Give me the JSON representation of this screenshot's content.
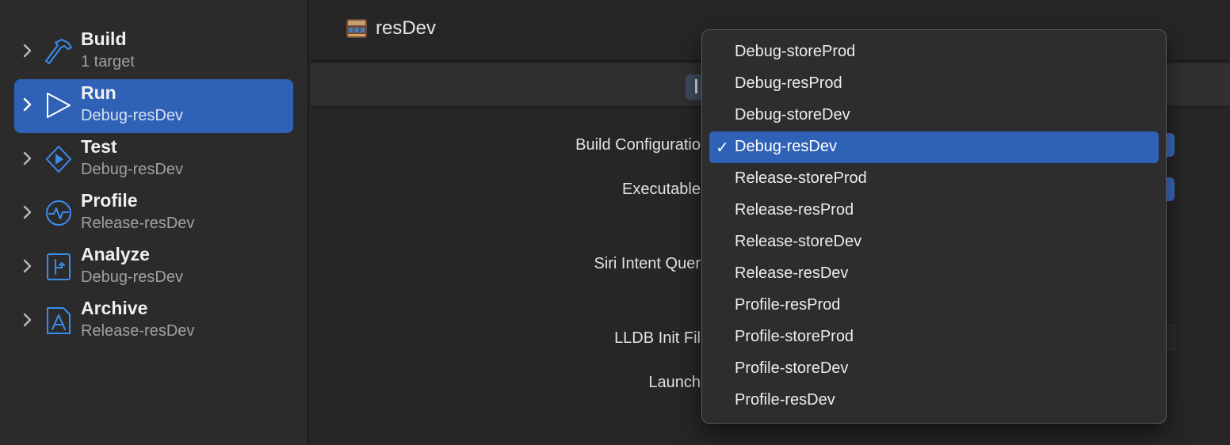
{
  "sidebar": {
    "items": [
      {
        "title": "Build",
        "subtitle": "1 target",
        "icon": "hammer-icon"
      },
      {
        "title": "Run",
        "subtitle": "Debug-resDev",
        "icon": "play-icon",
        "selected": true
      },
      {
        "title": "Test",
        "subtitle": "Debug-resDev",
        "icon": "test-diamond-icon"
      },
      {
        "title": "Profile",
        "subtitle": "Release-resDev",
        "icon": "waveform-icon"
      },
      {
        "title": "Analyze",
        "subtitle": "Debug-resDev",
        "icon": "analyze-icon"
      },
      {
        "title": "Archive",
        "subtitle": "Release-resDev",
        "icon": "archive-icon"
      }
    ]
  },
  "header": {
    "scheme_name": "resDev",
    "scheme_icon": "app-icon"
  },
  "settings": {
    "build_configuration_label": "Build Configuratio",
    "executable_label": "Executable",
    "siri_label": "Siri Intent Quer",
    "lldb_label": "LLDB Init Fil",
    "launch_label": "Launch"
  },
  "menu": {
    "check_glyph": "✓",
    "selected": "Debug-resDev",
    "items": [
      "Debug-storeProd",
      "Debug-resProd",
      "Debug-storeDev",
      "Debug-resDev",
      "Release-storeProd",
      "Release-resProd",
      "Release-storeDev",
      "Release-resDev",
      "Profile-resProd",
      "Profile-storeProd",
      "Profile-storeDev",
      "Profile-resDev"
    ]
  },
  "colors": {
    "accent": "#2f62b6",
    "icon_blue": "#3b8cf0",
    "background": "#262626",
    "sidebar": "#2b2b2b"
  }
}
